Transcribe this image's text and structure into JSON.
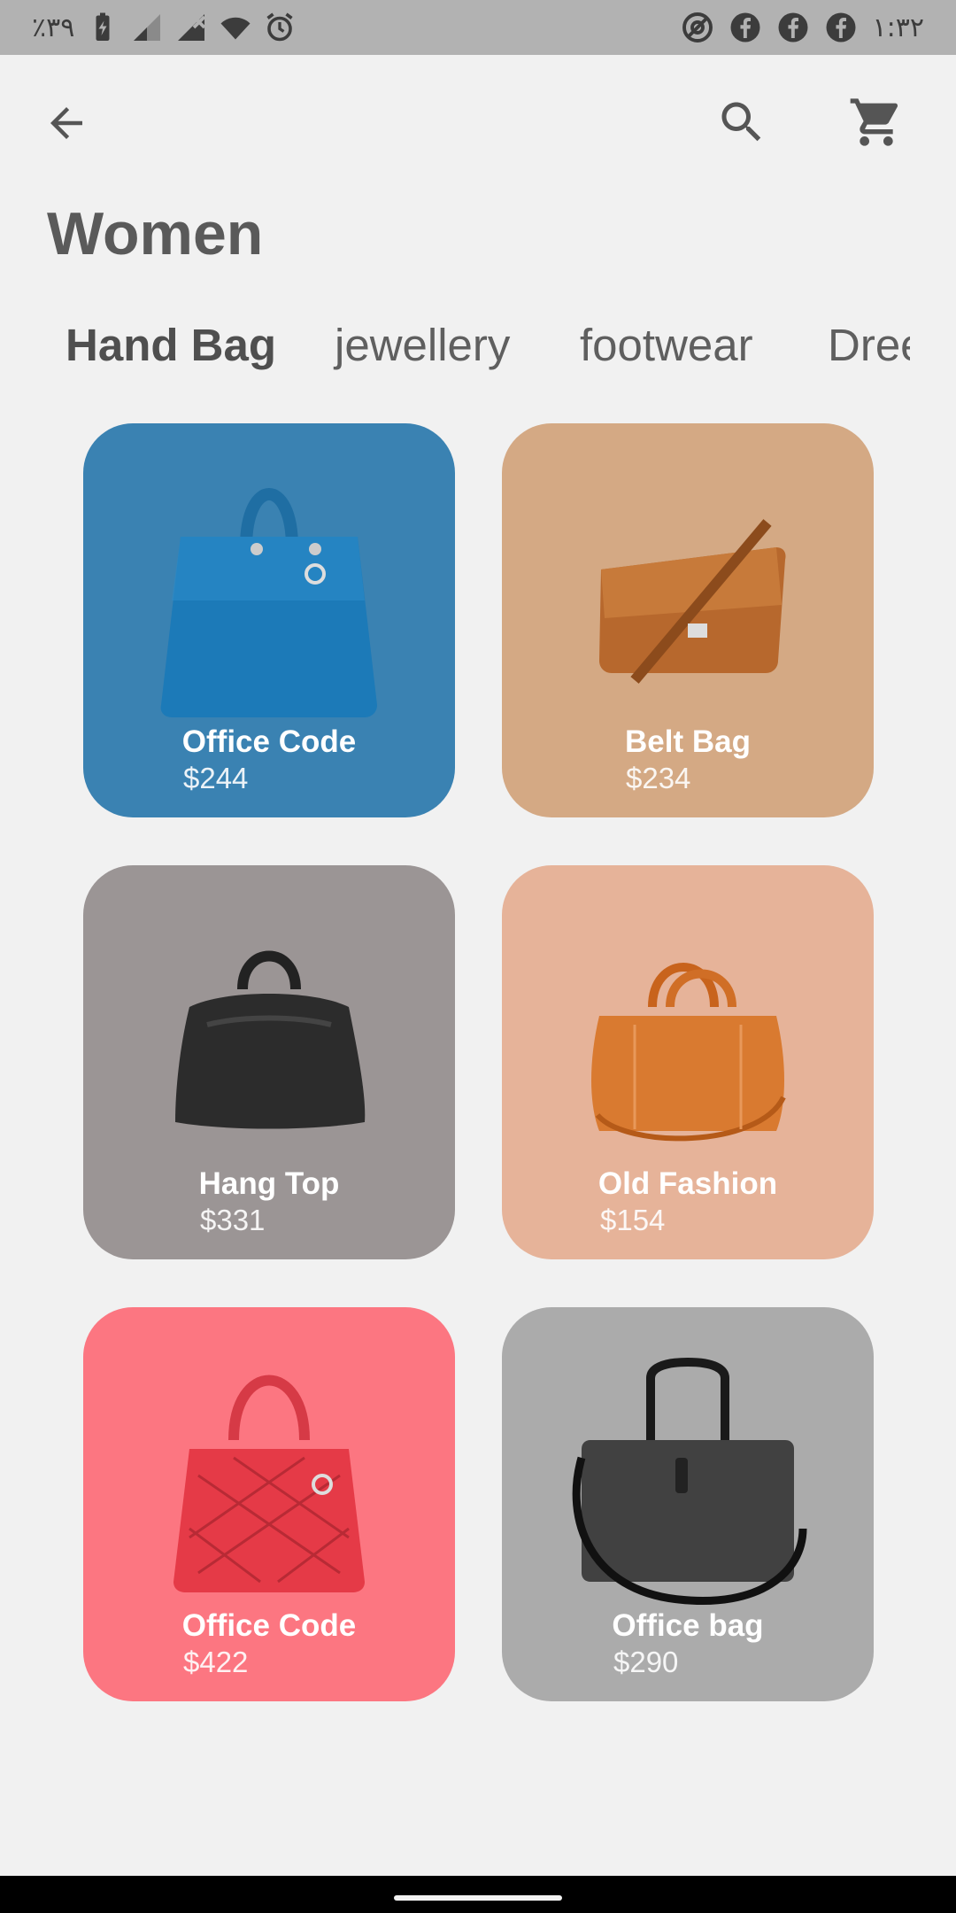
{
  "status_bar": {
    "battery_text": "٪۳۹",
    "time": "۱:۳۲",
    "icons_left": [
      "battery-icon",
      "signal-icon",
      "signal-off-icon",
      "wifi-icon",
      "alarm-icon"
    ],
    "icons_right": [
      "at-sign-icon",
      "facebook-icon",
      "facebook-icon",
      "facebook-icon"
    ]
  },
  "app_bar": {
    "back_icon": "arrow-left-icon",
    "search_icon": "search-icon",
    "cart_icon": "cart-icon"
  },
  "page": {
    "title": "Women"
  },
  "tabs": [
    {
      "label": "Hand Bag",
      "active": true
    },
    {
      "label": "jewellery",
      "active": false
    },
    {
      "label": "footwear",
      "active": false
    },
    {
      "label": "Dree",
      "active": false
    }
  ],
  "products": [
    {
      "name": "Office Code",
      "price": "$244",
      "color": "#3a82b2",
      "icon": "blue-handbag-icon"
    },
    {
      "name": "Belt Bag",
      "price": "$234",
      "color": "#d4a984",
      "icon": "brown-messenger-bag-icon"
    },
    {
      "name": "Hang Top",
      "price": "$331",
      "color": "#9b9595",
      "icon": "black-hobo-bag-icon"
    },
    {
      "name": "Old Fashion",
      "price": "$154",
      "color": "#e6b399",
      "icon": "orange-duffel-bag-icon"
    },
    {
      "name": "Office Code",
      "price": "$422",
      "color": "#fc7681",
      "icon": "red-quilted-handbag-icon"
    },
    {
      "name": "Office bag",
      "price": "$290",
      "color": "#ababab",
      "icon": "gray-laptop-bag-icon"
    }
  ]
}
